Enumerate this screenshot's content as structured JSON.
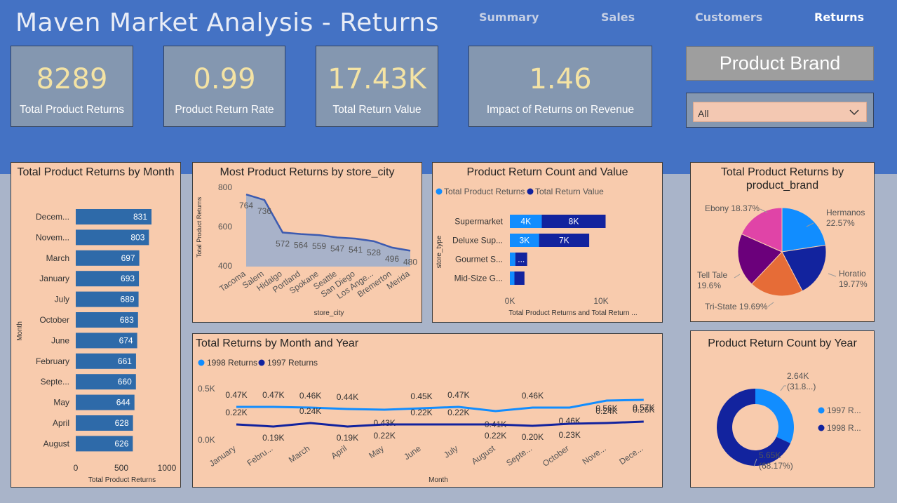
{
  "header": {
    "title": "Maven Market Analysis - Returns"
  },
  "nav": [
    "Summary",
    "Sales",
    "Customers",
    "Returns"
  ],
  "kpis": [
    {
      "value": "8289",
      "label": "Total Product Returns"
    },
    {
      "value": "0.99",
      "label": "Product Return Rate"
    },
    {
      "value": "17.43K",
      "label": "Total Return Value"
    },
    {
      "value": "1.46",
      "label": "Impact of Returns on Revenue"
    }
  ],
  "slicer": {
    "title": "Product Brand",
    "selected": "All"
  },
  "colors": {
    "header": "#4472c4",
    "panel": "#f8cbad",
    "bar": "#2e6aa9",
    "light_blue": "#118dff",
    "dark_blue": "#12239e"
  },
  "chart_data": [
    {
      "type": "bar",
      "title": "Total Product Returns by Month",
      "xlabel": "Total Product Returns",
      "ylabel": "Month",
      "categories": [
        "Decem...",
        "Novem...",
        "March",
        "January",
        "July",
        "October",
        "June",
        "February",
        "Septe...",
        "May",
        "April",
        "August"
      ],
      "values": [
        831,
        803,
        697,
        693,
        689,
        683,
        674,
        661,
        660,
        644,
        628,
        626
      ],
      "x_ticks": [
        "0",
        "500",
        "1000"
      ],
      "xlim": [
        0,
        1000
      ]
    },
    {
      "type": "area",
      "title": "Most Product Returns by store_city",
      "xlabel": "store_city",
      "ylabel": "Total Product Returns",
      "categories": [
        "Tacoma",
        "Salem",
        "Hidalgo",
        "Portland",
        "Spokane",
        "Seattle",
        "San Diego",
        "Los Ange...",
        "Bremerton",
        "Merida"
      ],
      "values": [
        764,
        736,
        572,
        564,
        559,
        547,
        541,
        528,
        496,
        480
      ],
      "y_ticks": [
        "800",
        "600",
        "400"
      ],
      "ylim": [
        400,
        800
      ]
    },
    {
      "type": "bar",
      "title": "Product Return Count and Value",
      "ylabel": "store_type",
      "xlabel": "Total Product Returns and Total Return ...",
      "categories": [
        "Supermarket",
        "Deluxe Sup...",
        "Gourmet S...",
        "Mid-Size G..."
      ],
      "series": [
        {
          "name": "Total Product Returns",
          "values": [
            3500,
            3200,
            600,
            500
          ],
          "labels": [
            "4K",
            "3K",
            "",
            ""
          ]
        },
        {
          "name": "Total Return Value",
          "values": [
            7000,
            5500,
            1300,
            1100
          ],
          "labels": [
            "8K",
            "7K",
            "...",
            ""
          ]
        }
      ],
      "x_ticks": [
        "0K",
        "10K"
      ],
      "xlim": [
        0,
        14000
      ]
    },
    {
      "type": "pie",
      "title": "Total Product Returns by product_brand",
      "slices": [
        {
          "name": "Hermanos",
          "pct": "22.57%",
          "value": 22.57
        },
        {
          "name": "Horatio",
          "pct": "19.77%",
          "value": 19.77
        },
        {
          "name": "Tri-State",
          "pct": "19.69%",
          "value": 19.69
        },
        {
          "name": "Tell Tale",
          "pct": "19.6%",
          "value": 19.6
        },
        {
          "name": "Ebony",
          "pct": "18.37%",
          "value": 18.37
        }
      ]
    },
    {
      "type": "line",
      "title": "Total Returns by Month and Year",
      "xlabel": "Month",
      "categories": [
        "January",
        "Febru...",
        "March",
        "April",
        "May",
        "June",
        "July",
        "August",
        "Septe...",
        "October",
        "Nove...",
        "Dece..."
      ],
      "series": [
        {
          "name": "1998 Returns",
          "values": [
            470,
            470,
            460,
            440,
            430,
            450,
            470,
            410,
            460,
            460,
            560,
            570
          ],
          "labels": [
            "0.47K",
            "0.47K",
            "0.46K",
            "0.44K",
            "0.43K",
            "0.45K",
            "0.47K",
            "0.41K",
            "0.46K",
            "0.46K",
            "0.56K",
            "0.57K"
          ]
        },
        {
          "name": "1997 Returns",
          "values": [
            220,
            190,
            240,
            190,
            220,
            220,
            220,
            220,
            200,
            230,
            240,
            260
          ],
          "labels": [
            "0.22K",
            "0.19K",
            "0.24K",
            "0.19K",
            "0.22K",
            "0.22K",
            "0.22K",
            "0.22K",
            "0.20K",
            "0.23K",
            "0.24K",
            "0.26K"
          ]
        }
      ],
      "y_ticks": [
        "0.5K",
        "0.0K"
      ]
    },
    {
      "type": "pie",
      "title": "Product Return Count by Year",
      "slices": [
        {
          "name": "1997 R...",
          "value_label": "2.64K",
          "pct": "(31.8...)",
          "value": 31.83
        },
        {
          "name": "1998 R...",
          "value_label": "5.65K",
          "pct": "(68.17%)",
          "value": 68.17
        }
      ]
    }
  ]
}
